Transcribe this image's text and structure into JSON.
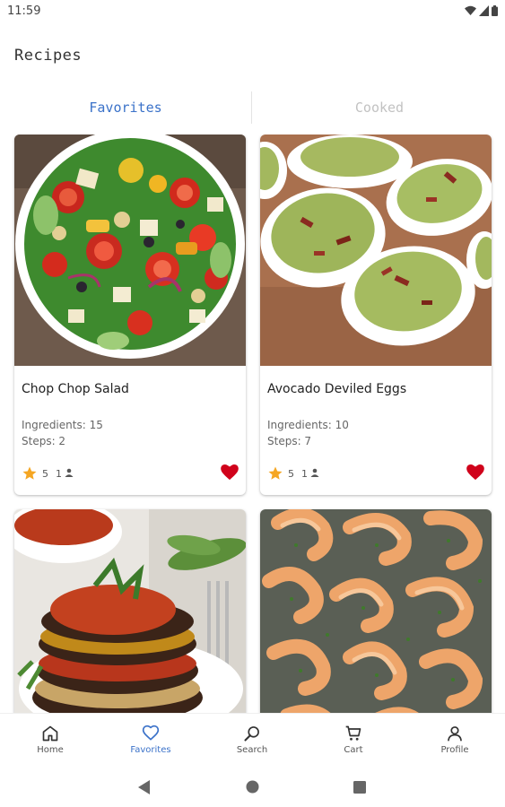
{
  "status_bar": {
    "time": "11:59"
  },
  "app": {
    "title": "Recipes"
  },
  "tabs": [
    {
      "label": "Favorites",
      "active": true
    },
    {
      "label": "Cooked",
      "active": false
    }
  ],
  "recipes": [
    {
      "title": "Chop Chop Salad",
      "ingredients": "Ingredients: 15",
      "steps": "Steps: 2",
      "rating": "5",
      "rating_count": "1",
      "favorite": true,
      "image_icon": "salad-photo"
    },
    {
      "title": "Avocado Deviled Eggs",
      "ingredients": "Ingredients: 10",
      "steps": "Steps: 7",
      "rating": "5",
      "rating_count": "1",
      "favorite": true,
      "image_icon": "deviled-eggs-photo"
    },
    {
      "image_icon": "eggplant-parmesan-photo"
    },
    {
      "image_icon": "roasted-shrimp-photo"
    }
  ],
  "bottom_nav": [
    {
      "label": "Home",
      "icon": "home-icon"
    },
    {
      "label": "Favorites",
      "icon": "heart-outline-icon",
      "active": true
    },
    {
      "label": "Search",
      "icon": "search-icon"
    },
    {
      "label": "Cart",
      "icon": "cart-icon"
    },
    {
      "label": "Profile",
      "icon": "profile-icon"
    }
  ],
  "colors": {
    "accent": "#3b72c9",
    "heart": "#d0021b",
    "star": "#f5a623",
    "inactive_tab": "#c2c2c2"
  }
}
